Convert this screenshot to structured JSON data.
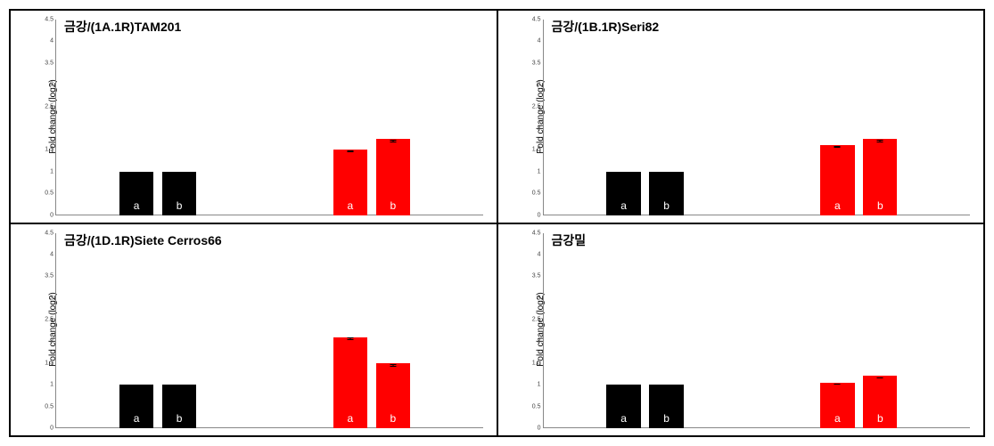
{
  "chart_data": [
    {
      "id": "panel0",
      "type": "bar",
      "title": "금강/(1A.1R)TAM201",
      "ylabel": "Fold change (log2)",
      "ylim": [
        0,
        4.5
      ],
      "ticks": [
        0,
        0.5,
        1,
        1.5,
        2,
        2.5,
        3,
        3.5,
        4,
        4.5
      ],
      "series": [
        {
          "name": "a",
          "pos": 0.15,
          "value": 1.0,
          "err": 0.05,
          "color": "black"
        },
        {
          "name": "b",
          "pos": 0.25,
          "value": 1.0,
          "err": 0.05,
          "color": "black"
        },
        {
          "name": "a",
          "pos": 0.65,
          "value": 1.5,
          "err": 0.05,
          "color": "red"
        },
        {
          "name": "b",
          "pos": 0.75,
          "value": 1.75,
          "err": 0.08,
          "color": "red"
        }
      ]
    },
    {
      "id": "panel1",
      "type": "bar",
      "title": "금강/(1B.1R)Seri82",
      "ylabel": "Fold change (log2)",
      "ylim": [
        0,
        4.5
      ],
      "ticks": [
        0,
        0.5,
        1,
        1.5,
        2,
        2.5,
        3,
        3.5,
        4,
        4.5
      ],
      "series": [
        {
          "name": "a",
          "pos": 0.15,
          "value": 1.0,
          "err": 0.05,
          "color": "black"
        },
        {
          "name": "b",
          "pos": 0.25,
          "value": 1.0,
          "err": 0.05,
          "color": "black"
        },
        {
          "name": "a",
          "pos": 0.65,
          "value": 1.6,
          "err": 0.06,
          "color": "red"
        },
        {
          "name": "b",
          "pos": 0.75,
          "value": 1.75,
          "err": 0.07,
          "color": "red"
        }
      ]
    },
    {
      "id": "panel2",
      "type": "bar",
      "title": "금강/(1D.1R)Siete Cerros66",
      "ylabel": "Fold change (log2)",
      "ylim": [
        0,
        4.5
      ],
      "ticks": [
        0,
        0.5,
        1,
        1.5,
        2,
        2.5,
        3,
        3.5,
        4,
        4.5
      ],
      "series": [
        {
          "name": "a",
          "pos": 0.15,
          "value": 1.0,
          "err": 0.05,
          "color": "black"
        },
        {
          "name": "b",
          "pos": 0.25,
          "value": 1.0,
          "err": 0.05,
          "color": "black"
        },
        {
          "name": "a",
          "pos": 0.65,
          "value": 2.1,
          "err": 0.07,
          "color": "red"
        },
        {
          "name": "b",
          "pos": 0.75,
          "value": 1.5,
          "err": 0.08,
          "color": "red"
        }
      ]
    },
    {
      "id": "panel3",
      "type": "bar",
      "title": "금강밀",
      "ylabel": "Fold change (log2)",
      "ylim": [
        0,
        4.5
      ],
      "ticks": [
        0,
        0.5,
        1,
        1.5,
        2,
        2.5,
        3,
        3.5,
        4,
        4.5
      ],
      "series": [
        {
          "name": "a",
          "pos": 0.15,
          "value": 1.0,
          "err": 0.05,
          "color": "black"
        },
        {
          "name": "b",
          "pos": 0.25,
          "value": 1.0,
          "err": 0.05,
          "color": "black"
        },
        {
          "name": "a",
          "pos": 0.65,
          "value": 1.05,
          "err": 0.05,
          "color": "red"
        },
        {
          "name": "b",
          "pos": 0.75,
          "value": 1.2,
          "err": 0.06,
          "color": "red"
        }
      ]
    }
  ]
}
